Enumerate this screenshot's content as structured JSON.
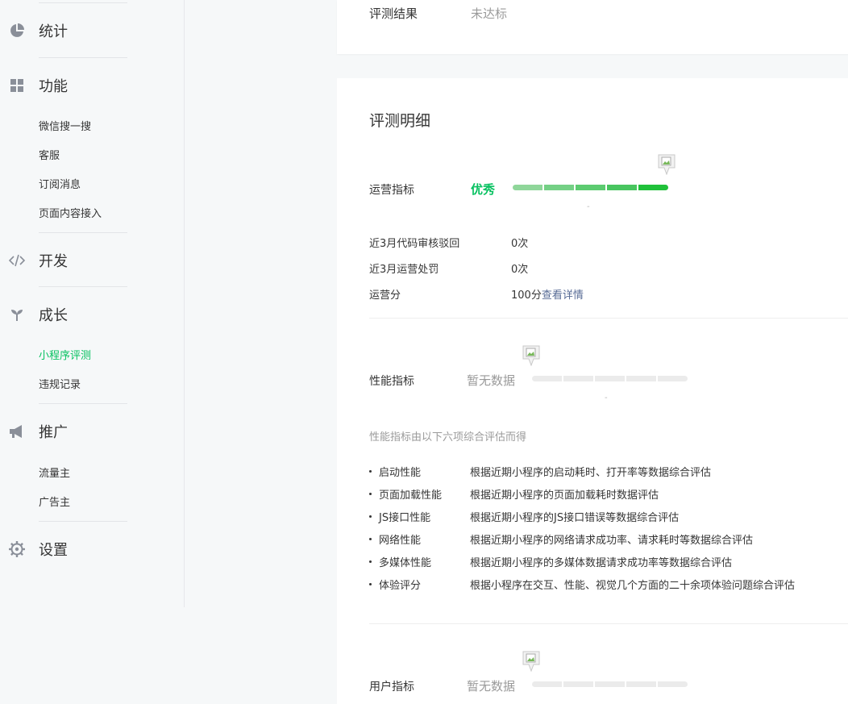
{
  "sidebar": {
    "sections": [
      {
        "id": "stats",
        "label": "统计",
        "icon": "pie-chart-icon"
      },
      {
        "id": "features",
        "label": "功能",
        "icon": "grid-icon",
        "items": [
          "微信搜一搜",
          "客服",
          "订阅消息",
          "页面内容接入"
        ]
      },
      {
        "id": "dev",
        "label": "开发",
        "icon": "code-icon"
      },
      {
        "id": "growth",
        "label": "成长",
        "icon": "sprout-icon",
        "items": [
          "小程序评测",
          "违规记录"
        ],
        "active_item": "小程序评测"
      },
      {
        "id": "promo",
        "label": "推广",
        "icon": "megaphone-icon",
        "items": [
          "流量主",
          "广告主"
        ]
      },
      {
        "id": "settings",
        "label": "设置",
        "icon": "gear-icon"
      }
    ]
  },
  "result_card": {
    "label": "评测结果",
    "value": "未达标"
  },
  "detail_card": {
    "title": "评测明细",
    "operation": {
      "label": "运营指标",
      "rating": "优秀",
      "rating_color": "#07c160",
      "level": 5,
      "level_max": 5,
      "dash": "-",
      "rows": [
        {
          "label": "近3月代码审核驳回",
          "value": "0次"
        },
        {
          "label": "近3月运营处罚",
          "value": "0次"
        },
        {
          "label": "运营分",
          "value": "100分",
          "link": "查看详情"
        }
      ]
    },
    "performance": {
      "label": "性能指标",
      "rating": "暂无数据",
      "level": 0,
      "level_max": 5,
      "dash": "-",
      "note": "性能指标由以下六项综合评估而得",
      "items": [
        {
          "name": "启动性能",
          "desc": "根据近期小程序的启动耗时、打开率等数据综合评估"
        },
        {
          "name": "页面加载性能",
          "desc": "根据近期小程序的页面加载耗时数据评估"
        },
        {
          "name": "JS接口性能",
          "desc": "根据近期小程序的JS接口错误等数据综合评估"
        },
        {
          "name": "网络性能",
          "desc": "根据近期小程序的网络请求成功率、请求耗时等数据综合评估"
        },
        {
          "name": "多媒体性能",
          "desc": "根据近期小程序的多媒体数据请求成功率等数据综合评估"
        },
        {
          "name": "体验评分",
          "desc": "根据小程序在交互、性能、视觉几个方面的二十余项体验问题综合评估"
        }
      ]
    },
    "user": {
      "label": "用户指标",
      "rating": "暂无数据",
      "level": 0,
      "level_max": 5
    }
  },
  "colors": {
    "accent": "#07c160",
    "link": "#576b95",
    "bar_empty": "#ebebeb",
    "bar_filled": [
      "#8fd69a",
      "#74d085",
      "#5ccb70",
      "#48c55f",
      "#20c13a"
    ]
  }
}
